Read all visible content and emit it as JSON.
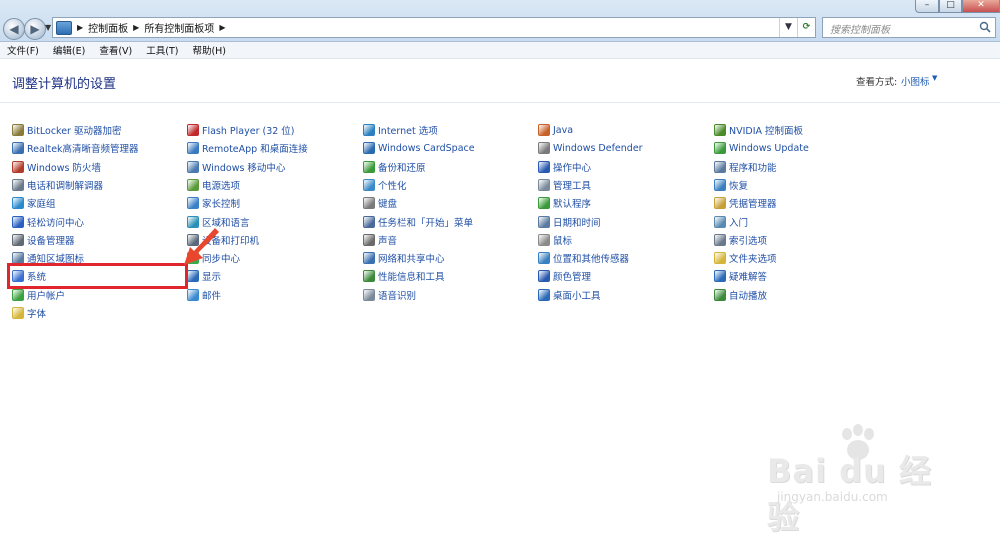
{
  "window": {
    "address": {
      "crumbs": [
        "控制面板",
        "所有控制面板项"
      ]
    },
    "search": {
      "placeholder": "搜索控制面板"
    }
  },
  "menubar": [
    "文件(F)",
    "编辑(E)",
    "查看(V)",
    "工具(T)",
    "帮助(H)"
  ],
  "content": {
    "title": "调整计算机的设置",
    "view_by_label": "查看方式:",
    "view_by_value": "小图标"
  },
  "columns": [
    [
      {
        "label": "BitLocker 驱动器加密",
        "color": "#8a7a3a"
      },
      {
        "label": "Realtek高清晰音频管理器",
        "color": "#3a6fb0"
      },
      {
        "label": "Windows 防火墙",
        "color": "#b23c2a"
      },
      {
        "label": "电话和调制解调器",
        "color": "#6a7a8a"
      },
      {
        "label": "家庭组",
        "color": "#2a8acb"
      },
      {
        "label": "轻松访问中心",
        "color": "#2a60c0"
      },
      {
        "label": "设备管理器",
        "color": "#606a74"
      },
      {
        "label": "通知区域图标",
        "color": "#5a7aa0"
      },
      {
        "label": "系统",
        "color": "#3a6fd0"
      },
      {
        "label": "用户帐户",
        "color": "#3aa040"
      },
      {
        "label": "字体",
        "color": "#d4b53a"
      }
    ],
    [
      {
        "label": "Flash Player (32 位)",
        "color": "#c0282a"
      },
      {
        "label": "RemoteApp 和桌面连接",
        "color": "#3a7ac0"
      },
      {
        "label": "Windows 移动中心",
        "color": "#4a7ab0"
      },
      {
        "label": "电源选项",
        "color": "#5a9a3a"
      },
      {
        "label": "家长控制",
        "color": "#3a80c8"
      },
      {
        "label": "区域和语言",
        "color": "#2a90b8"
      },
      {
        "label": "设备和打印机",
        "color": "#5a6a7a"
      },
      {
        "label": "同步中心",
        "color": "#3aaa4a"
      },
      {
        "label": "显示",
        "color": "#2a6ab8"
      },
      {
        "label": "邮件",
        "color": "#3a8ad0"
      }
    ],
    [
      {
        "label": "Internet 选项",
        "color": "#2a80c0"
      },
      {
        "label": "Windows CardSpace",
        "color": "#2a6ab0"
      },
      {
        "label": "备份和还原",
        "color": "#3a9a3a"
      },
      {
        "label": "个性化",
        "color": "#3a8ac8"
      },
      {
        "label": "键盘",
        "color": "#7a7a7a"
      },
      {
        "label": "任务栏和「开始」菜单",
        "color": "#4a6a9a"
      },
      {
        "label": "声音",
        "color": "#6a6a6a"
      },
      {
        "label": "网络和共享中心",
        "color": "#3a70b0"
      },
      {
        "label": "性能信息和工具",
        "color": "#3a8a3a"
      },
      {
        "label": "语音识别",
        "color": "#7a8a9a"
      }
    ],
    [
      {
        "label": "Java",
        "color": "#c8602a"
      },
      {
        "label": "Windows Defender",
        "color": "#7a7a7a"
      },
      {
        "label": "操作中心",
        "color": "#2a5ab0"
      },
      {
        "label": "管理工具",
        "color": "#7a8a9a"
      },
      {
        "label": "默认程序",
        "color": "#3a9a3a"
      },
      {
        "label": "日期和时间",
        "color": "#5a7aa0"
      },
      {
        "label": "鼠标",
        "color": "#8a8a8a"
      },
      {
        "label": "位置和其他传感器",
        "color": "#3a80c0"
      },
      {
        "label": "颜色管理",
        "color": "#2a5ab0"
      },
      {
        "label": "桌面小工具",
        "color": "#2a6ab8"
      }
    ],
    [
      {
        "label": "NVIDIA 控制面板",
        "color": "#4a8a2a"
      },
      {
        "label": "Windows Update",
        "color": "#3a9a3a"
      },
      {
        "label": "程序和功能",
        "color": "#5a7aa0"
      },
      {
        "label": "恢复",
        "color": "#3a80c0"
      },
      {
        "label": "凭据管理器",
        "color": "#c8a03a"
      },
      {
        "label": "入门",
        "color": "#5a8ab0"
      },
      {
        "label": "索引选项",
        "color": "#6a7a8a"
      },
      {
        "label": "文件夹选项",
        "color": "#d4b53a"
      },
      {
        "label": "疑难解答",
        "color": "#2a6ab8"
      },
      {
        "label": "自动播放",
        "color": "#3a8a3a"
      }
    ]
  ],
  "watermark": {
    "brand": "Bai du 经验",
    "url": "jingyan.baidu.com"
  }
}
